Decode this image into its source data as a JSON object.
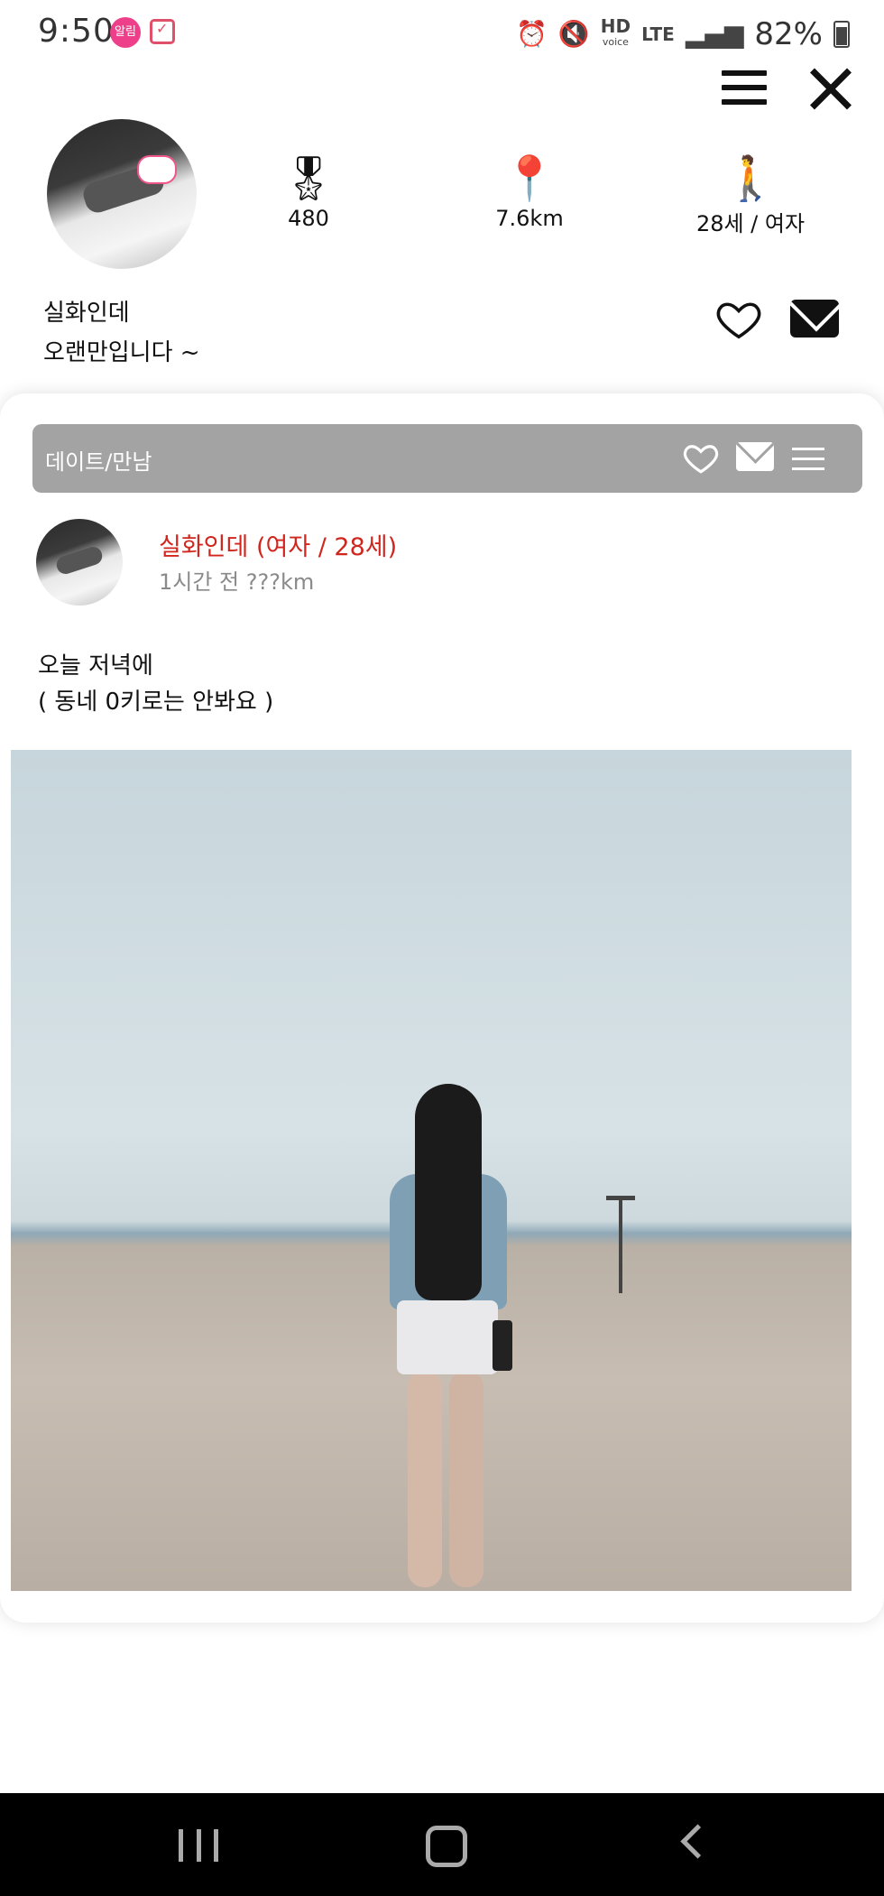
{
  "status_bar": {
    "time": "9:50",
    "app_badge": "알림",
    "hd_label": "HD",
    "hd_sub": "voice",
    "lte_label": "LTE",
    "battery_percent": "82%",
    "battery_level": 0.82
  },
  "profile": {
    "points": "480",
    "distance": "7.6km",
    "age_gender": "28세 / 여자",
    "bio_line1": "실화인데",
    "bio_line2": "오랜만입니다 ~"
  },
  "post": {
    "category": "데이트/만남",
    "author": "실화인데 (여자 / 28세)",
    "meta": "1시간 전 ???km",
    "text": "오늘 저녁에\n( 동네 0키로는 안봐요 )"
  },
  "colors": {
    "author_name": "#d0261d",
    "card_bar": "#a3a3a3",
    "nav_background": "#000000"
  },
  "icons": {
    "menu": "hamburger-icon",
    "close": "close-icon",
    "points": "award-ribbon-icon",
    "distance": "map-pin-icon",
    "age": "person-icon",
    "like": "heart-icon",
    "message": "mail-icon"
  }
}
